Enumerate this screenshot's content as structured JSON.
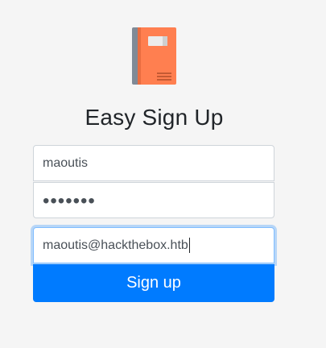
{
  "heading": "Easy Sign Up",
  "form": {
    "username_value": "maoutis",
    "password_masked": "•••••••",
    "email_value": "maoutis@hackthebox.htb",
    "submit_label": "Sign up"
  },
  "colors": {
    "accent": "#007bff",
    "book_cover": "#ff7f50",
    "book_spine": "#808a96"
  },
  "icons": {
    "logo": "book-icon"
  }
}
